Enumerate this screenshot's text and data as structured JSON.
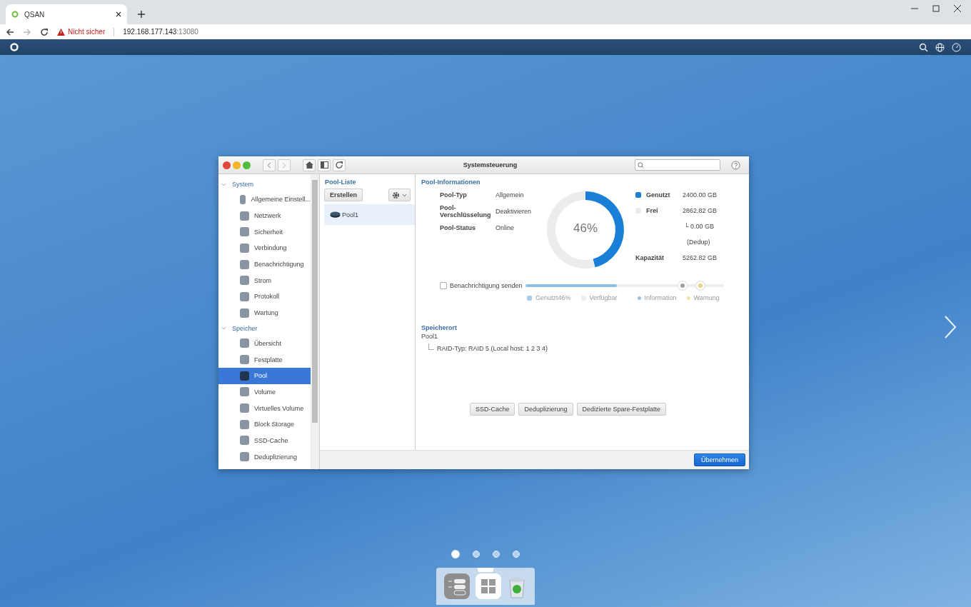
{
  "browser": {
    "tab": {
      "title": "QSAN"
    },
    "security": "Nicht sicher",
    "url_host": "192.168.177.143",
    "url_port": ":13080"
  },
  "window": {
    "title": "Systemsteuerung"
  },
  "sidebar": {
    "sections": [
      {
        "label": "System",
        "expanded": true,
        "children": [
          {
            "label": "Allgemeine Einstell...",
            "selected": false
          },
          {
            "label": "Netzwerk",
            "selected": false
          },
          {
            "label": "Sicherheit",
            "selected": false
          },
          {
            "label": "Verbindung",
            "selected": false
          },
          {
            "label": "Benachrichtigung",
            "selected": false
          },
          {
            "label": "Strom",
            "selected": false
          },
          {
            "label": "Protokoll",
            "selected": false
          },
          {
            "label": "Wartung",
            "selected": false
          }
        ]
      },
      {
        "label": "Speicher",
        "expanded": true,
        "children": [
          {
            "label": "Übersicht",
            "selected": false
          },
          {
            "label": "Festplatte",
            "selected": false
          },
          {
            "label": "Pool",
            "selected": true
          },
          {
            "label": "Volume",
            "selected": false
          },
          {
            "label": "Virtuelles Volume",
            "selected": false
          },
          {
            "label": "Block Storage",
            "selected": false
          },
          {
            "label": "SSD-Cache",
            "selected": false
          },
          {
            "label": "Deduplizierung",
            "selected": false
          }
        ]
      }
    ]
  },
  "pool_list": {
    "title": "Pool-Liste",
    "create_button": "Erstellen",
    "items": [
      {
        "label": "Pool1",
        "selected": true
      }
    ]
  },
  "pool_info": {
    "title": "Pool-Informationen",
    "fields": [
      {
        "label": "Pool-Typ",
        "value": "Allgemein"
      },
      {
        "label": "Pool-Verschlüsselung",
        "value": "Deaktivieren"
      },
      {
        "label": "Pool-Status",
        "value": "Online"
      }
    ],
    "donut_label": "46%",
    "chart_data": {
      "type": "donut",
      "categories": [
        "Genutzt",
        "Frei"
      ],
      "series": [
        {
          "values": [
            46,
            54
          ]
        }
      ]
    },
    "legend": [
      {
        "value": "2400.00 GB",
        "color": "#1a7fd6"
      },
      {
        "value": "2862.82 GB",
        "color": "#ececec"
      }
    ],
    "dedup_value": "└ 0.00 GB",
    "dedup_label": "(Dedup)",
    "capacity": {
      "label": "Kapazität",
      "value": "5262.82 GB"
    },
    "notify": {
      "label": "Benachrichtigung senden",
      "checked": false
    },
    "usage_bar": {
      "level": 0.46,
      "handles": [
        {
          "level": 0.79,
          "color": "#a0a0a0"
        },
        {
          "level": 0.88,
          "color": "#e8d27a"
        }
      ]
    },
    "bar_legend": [
      {
        "label": "Genutzt46%",
        "color": "#a9cde9"
      },
      {
        "label": "Verfügbar",
        "color": "#eeeeee"
      },
      {
        "label": "Information",
        "color": "#9cc3dc"
      },
      {
        "label": "Warnung",
        "color": "#f2e3a0"
      }
    ]
  },
  "location": {
    "title": "Speicherort",
    "pool": "Pool1",
    "raid": "RAID-Typ: RAID 5 (Local host: 1 2 3 4)"
  },
  "action_buttons": [
    "SSD-Cache",
    "Deduplizierung",
    "Dedizierte Spare-Festplatte"
  ],
  "apply_button": "Übernehmen",
  "pages": [
    {
      "selected": true
    },
    {
      "selected": false
    },
    {
      "selected": false
    },
    {
      "selected": false
    }
  ]
}
